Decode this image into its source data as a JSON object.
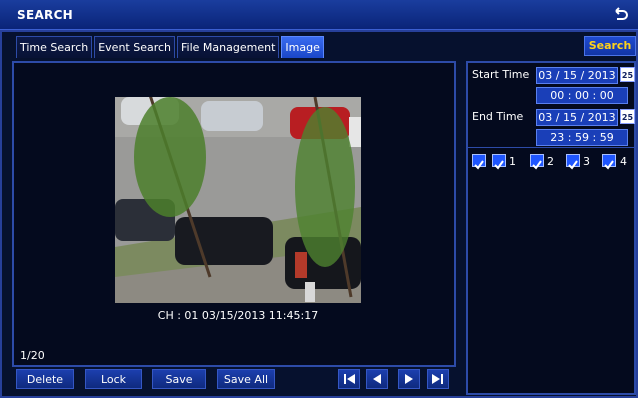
{
  "title": "SEARCH",
  "tabs": [
    {
      "label": "Time Search"
    },
    {
      "label": "Event Search"
    },
    {
      "label": "File Management"
    },
    {
      "label": "Image"
    }
  ],
  "search_label": "Search",
  "preview": {
    "caption": "CH : 01  03/15/2013 11:45:17",
    "page_counter": "1/20"
  },
  "buttons": {
    "delete": "Delete",
    "lock": "Lock",
    "save": "Save",
    "save_all": "Save All"
  },
  "start_time": {
    "label": "Start Time",
    "date": "03 / 15 / 2013",
    "time": "00 :  00 :  00"
  },
  "end_time": {
    "label": "End Time",
    "date": "03 / 15 / 2013",
    "time": "23 :  59 :  59"
  },
  "calendar_badge": "25",
  "channels": [
    "1",
    "2",
    "3",
    "4"
  ],
  "colors": {
    "accent": "#1f56ff",
    "highlight": "#ffd21a",
    "background": "#06112e"
  }
}
